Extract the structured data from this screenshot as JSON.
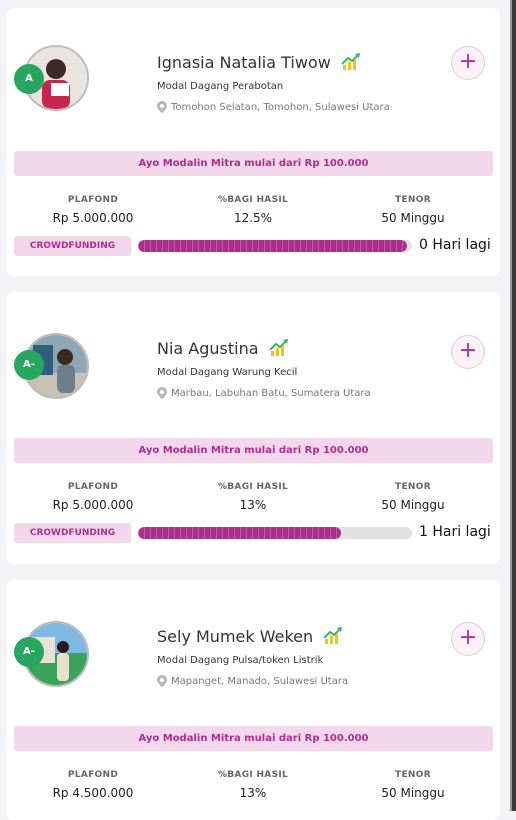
{
  "cards": [
    {
      "grade": "A",
      "name": "Ignasia Natalia Tiwow",
      "purpose": "Modal Dagang Perabotan",
      "location": "Tomohon Selatan, Tomohon, Sulawesi Utara",
      "promo": "Ayo Modalin Mitra mulai dari Rp 100.000",
      "plafond_label": "PLAFOND",
      "plafond": "Rp 5.000.000",
      "bagi_label": "%BAGI HASIL",
      "bagi": "12.5%",
      "tenor_label": "TENOR",
      "tenor": "50 Minggu",
      "badge": "CROWDFUNDING",
      "progress": 0.98,
      "days": "0 Hari lagi"
    },
    {
      "grade": "A-",
      "name": "Nia Agustina",
      "purpose": "Modal Dagang Warung Kecil",
      "location": "Marbau, Labuhan Batu, Sumatera Utara",
      "promo": "Ayo Modalin Mitra mulai dari Rp 100.000",
      "plafond_label": "PLAFOND",
      "plafond": "Rp 5.000.000",
      "bagi_label": "%BAGI HASIL",
      "bagi": "13%",
      "tenor_label": "TENOR",
      "tenor": "50 Minggu",
      "badge": "CROWDFUNDING",
      "progress": 0.74,
      "days": "1 Hari lagi"
    },
    {
      "grade": "A-",
      "name": "Sely Mumek Weken",
      "purpose": "Modal Dagang Pulsa/token Listrik",
      "location": "Mapanget, Manado, Sulawesi Utara",
      "promo": "Ayo Modalin Mitra mulai dari Rp 100.000",
      "plafond_label": "PLAFOND",
      "plafond": "Rp 4.500.000",
      "bagi_label": "%BAGI HASIL",
      "bagi": "13%",
      "tenor_label": "TENOR",
      "tenor": "50 Minggu"
    }
  ],
  "colors": {
    "accent": "#b02d90",
    "grade": "#27a660",
    "promo_bg": "#f3d8ec"
  },
  "icons": {
    "trend": "trending-up-icon",
    "pin": "location-pin-icon",
    "add": "plus-icon"
  }
}
